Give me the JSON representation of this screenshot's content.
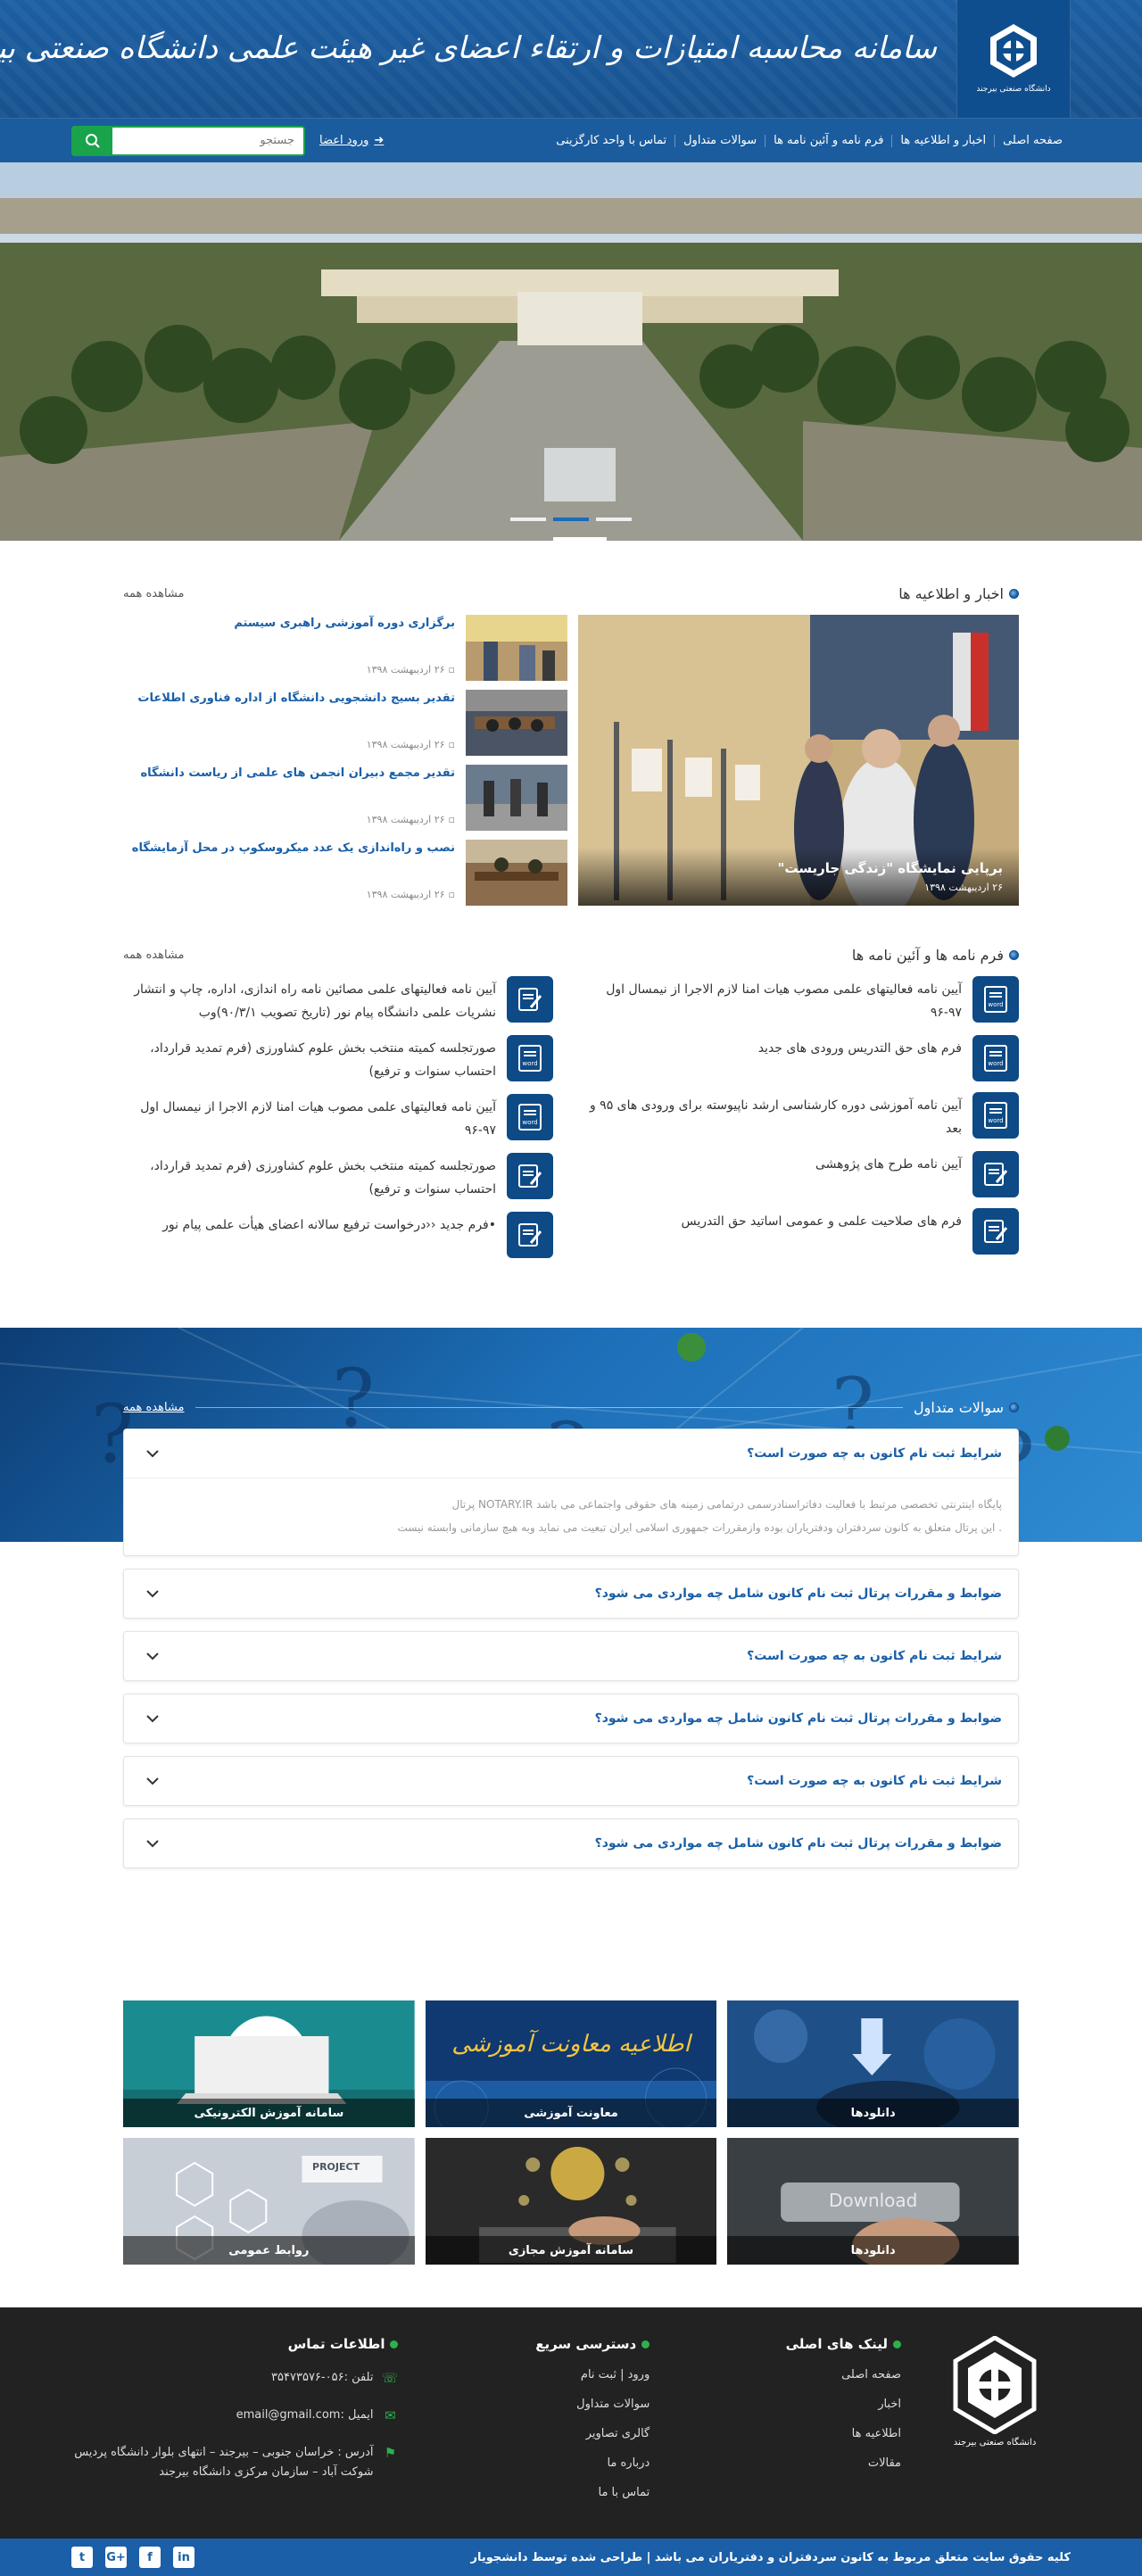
{
  "header": {
    "title": "سامانه محاسبه امتیازات و ارتقاء اعضای غیر هیئت علمی دانشگاه صنعتی بیرجند",
    "logo_sub": "دانشگاه صنعتی بیرجند"
  },
  "nav": {
    "items": [
      "صفحه اصلی",
      "اخبار و اطلاعیه ها",
      "فرم نامه و آئین نامه ها",
      "سوالات متداول",
      "تماس  با واحد کارگزینی"
    ],
    "login_label": "ورود اعضا",
    "search_placeholder": "جستجو"
  },
  "news": {
    "title": "اخبار و اطلاعیه ها",
    "see_all": "مشاهده همه",
    "featured": {
      "title": "برپایی نمایشگاه \"زندگی جاریست\"",
      "date": "۲۶ اردیبهشت ۱۳۹۸"
    },
    "items": [
      {
        "title": "برگزاری دوره آموزشی راهبری سیستم",
        "date": "۲۶ اردیبهشت ۱۳۹۸"
      },
      {
        "title": "تقدیر بسیج دانشجویی دانشگاه از اداره فناوری اطلاعات",
        "date": "۲۶ اردیبهشت ۱۳۹۸"
      },
      {
        "title": "تقدیر مجمع دبیران انجمن های علمی از ریاست دانشگاه",
        "date": "۲۶ اردیبهشت ۱۳۹۸"
      },
      {
        "title": "نصب و راه‌اندازی یک عدد میکروسکوپ در محل آزمایشگاه",
        "date": "۲۶ اردیبهشت ۱۳۹۸"
      }
    ]
  },
  "forms": {
    "title": "فرم نامه ها و آئین نامه ها",
    "see_all": "مشاهده همه",
    "right": [
      {
        "text": "آیین نامه فعالیتهای علمی مصوب هیات امنا لازم الاجرا از نیمسال اول ۹۷-۹۶",
        "icon": "word"
      },
      {
        "text": "فرم های حق التدریس ورودی های جدید",
        "icon": "word"
      },
      {
        "text": "آیین نامه آموزشی دوره کارشناسی ارشد ناپیوسته برای ورودی های ۹۵ و بعد",
        "icon": "word"
      },
      {
        "text": "آیین نامه طرح های پژوهشی",
        "icon": "edit"
      },
      {
        "text": "فرم های صلاحیت علمی و عمومی اساتید حق التدریس",
        "icon": "edit"
      }
    ],
    "left": [
      {
        "text": "آیین نامه فعالیتهای علمی مصائین نامه راه اندازی، اداره، چاپ و انتشار نشریات علمی دانشگاه پیام نور (تاریخ تصویب ۹۰/۳/۱)وب",
        "icon": "edit"
      },
      {
        "text": "صورتجلسه کمیته منتخب بخش علوم کشاورزی (فرم تمدید قرارداد، احتساب سنوات و ترفیع)",
        "icon": "word"
      },
      {
        "text": "آیین نامه فعالیتهای علمی مصوب هیات امنا لازم الاجرا از نیمسال اول ۹۷-۹۶",
        "icon": "word"
      },
      {
        "text": "صورتجلسه کمیته منتخب بخش علوم کشاورزی (فرم تمدید قرارداد، احتساب سنوات و ترفیع)",
        "icon": "edit"
      },
      {
        "text": "•فرم جدید ‹‹درخواست ترفیع سالانه اعضای هیأت علمی پیام نور",
        "icon": "edit"
      }
    ]
  },
  "faq": {
    "title": "سوالات متداول",
    "see_all": "مشاهده همه",
    "open": {
      "question": "شرایط ثبت نام کانون به چه صورت است؟",
      "answer1": "پایگاه اینترنتی تخصصی مرتبط با فعالیت دفاتراسنادرسمی درتمامی زمینه های حقوقی واجتماعی می باشد NOTARY.IR پرتال",
      "answer2": ". این پرتال متعلق به کانون سردفتران ودفتریاران بوده وازمقررات جمهوری اسلامی ایران تبعیت می نماید وبه هیچ سازمانی وابسته نیست"
    },
    "items": [
      "ضوابط و مقررات پرتال ثبت نام  کانون  شامل چه مواردی می شود؟",
      "شرایط ثبت نام کانون به چه صورت است؟",
      "ضوابط و مقررات پرتال ثبت نام  کانون  شامل چه مواردی می شود؟",
      "شرایط ثبت نام کانون به چه صورت است؟",
      "ضوابط و مقررات پرتال ثبت نام  کانون  شامل چه مواردی می شود؟"
    ]
  },
  "tiles": [
    {
      "label": "دانلودها"
    },
    {
      "label": "معاونت آموزشی",
      "banner": "اطلاعیه معاونت آموزشی"
    },
    {
      "label": "سامانه آموزش الکترونیکی"
    },
    {
      "label": "دانلودها",
      "overlay": "Download"
    },
    {
      "label": "سامانه آموزش مجازی"
    },
    {
      "label": "روابط عمومی",
      "overlay": "PROJECT"
    }
  ],
  "footer": {
    "main_links_title": "لینک های اصلی",
    "main_links": [
      "صفحه اصلی",
      "اخبار",
      "اطلاعیه ها",
      "مقالات"
    ],
    "quick_title": "دسترسی  سریع",
    "quick_links": [
      "ورود | ثبت نام",
      "سوالات متداول",
      "گالری تصاویر",
      "درباره ما",
      "تماس با ما"
    ],
    "contact_title": "اطلاعات تماس",
    "phone": "تلفن :۰۵۶-۳۵۴۷۳۵۷۶",
    "email": "ایمیل :email@gmail.com",
    "address": "آدرس : خراسان جنوبی – بیرجند – انتهای بلوار دانشگاه  پردیس شوکت آباد – سازمان مرکزی دانشگاه بیرجند",
    "logo_sub": "دانشگاه صنعتی بیرجند",
    "copyright": "کلیه حقوق سایت متعلق مربوط به کانون سردفتران و دفتریاران می باشد  |  طراحی شده توسط دانشجویار"
  },
  "colors": {
    "primary": "#1a5fa8",
    "dark_blue": "#0d4a86",
    "green": "#19a34a",
    "footer_bg": "#222222"
  }
}
